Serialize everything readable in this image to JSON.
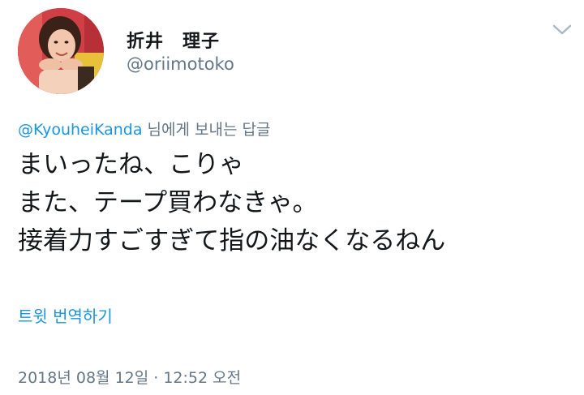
{
  "author": {
    "display_name": "折井　理子",
    "handle": "@oriimotoko",
    "avatar_icon": "profile-photo"
  },
  "menu": {
    "icon": "chevron-down-icon",
    "color": "#aab8c2"
  },
  "reply": {
    "mention": "@KyouheiKanda",
    "suffix": " 님에게 보내는 답글"
  },
  "tweet": {
    "lines": [
      "まいったね、こりゃ",
      "また、テープ買わなきゃ。",
      "接着力すごすぎて指の油なくなるねん"
    ]
  },
  "translate": {
    "label": "트윗 번역하기"
  },
  "timestamp": {
    "text": "2018년 08월 12일 · 12:52 오전"
  },
  "colors": {
    "link": "#1b95e0",
    "secondary_text": "#657786",
    "primary_text": "#14171a"
  }
}
